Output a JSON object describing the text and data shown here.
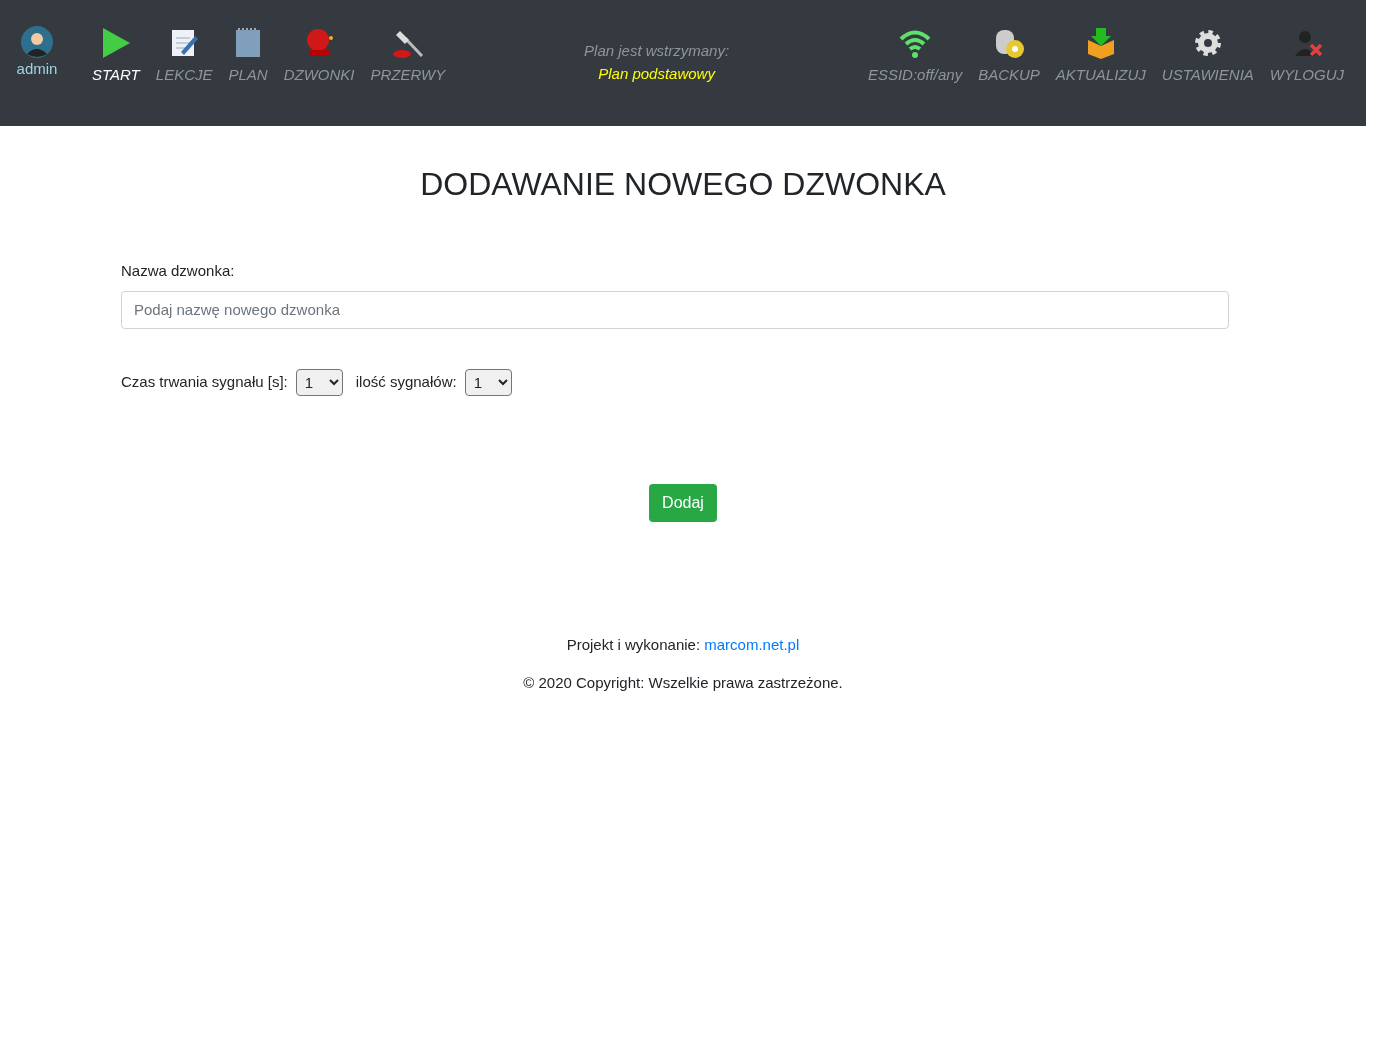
{
  "user": {
    "name": "admin"
  },
  "nav_left": [
    {
      "label": "START",
      "kind": "play",
      "selected": true
    },
    {
      "label": "LEKCJE",
      "kind": "notepad",
      "selected": false
    },
    {
      "label": "PLAN",
      "kind": "notebook",
      "selected": false
    },
    {
      "label": "DZWONKI",
      "kind": "bell",
      "selected": false
    },
    {
      "label": "PRZERWY",
      "kind": "hammer",
      "selected": false
    }
  ],
  "plan_status": {
    "label": "Plan jest wstrzymany:",
    "plan": "Plan podstawowy"
  },
  "nav_right": [
    {
      "label": "ESSID:off/any",
      "kind": "wifi"
    },
    {
      "label": "BACKUP",
      "kind": "disk"
    },
    {
      "label": "AKTUALIZUJ",
      "kind": "box"
    },
    {
      "label": "USTAWIENIA",
      "kind": "gear"
    },
    {
      "label": "WYLOGUJ",
      "kind": "logout"
    }
  ],
  "heading": "DODAWANIE NOWEGO DZWONKA",
  "name_field": {
    "label": "Nazwa dzwonka:",
    "placeholder": "Podaj nazwę nowego dzwonka"
  },
  "duration": {
    "label": "Czas trwania sygnału [s]:",
    "value": "1"
  },
  "count": {
    "label": "ilość sygnałów:",
    "value": "1"
  },
  "submit": "Dodaj",
  "footer": {
    "credit": "Projekt i wykonanie:",
    "link": "marcom.net.pl",
    "copyright": "© 2020 Copyright: Wszelkie prawa zastrzeżone."
  }
}
